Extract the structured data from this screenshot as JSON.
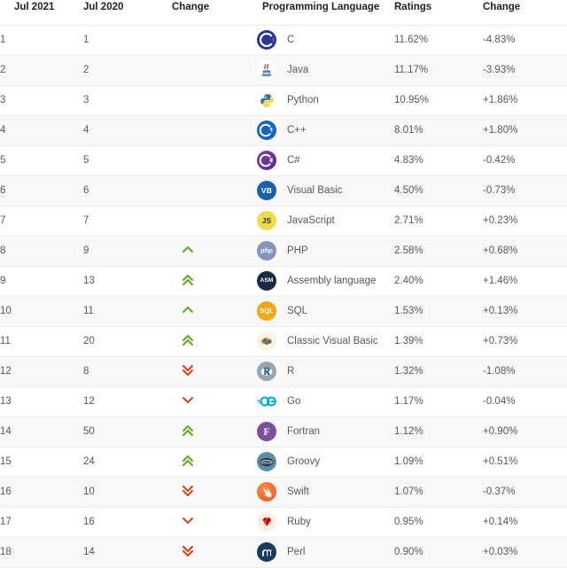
{
  "table": {
    "headers": {
      "rank_new": "Jul 2021",
      "rank_old": "Jul 2020",
      "change": "Change",
      "language": "Programming Language",
      "ratings": "Ratings",
      "delta": "Change"
    },
    "rows": [
      {
        "rank_new": "1",
        "rank_old": "1",
        "change": "",
        "icon": "c-logo-icon",
        "language": "C",
        "ratings": "11.62%",
        "delta": "-4.83%"
      },
      {
        "rank_new": "2",
        "rank_old": "2",
        "change": "",
        "icon": "java-logo-icon",
        "language": "Java",
        "ratings": "11.17%",
        "delta": "-3.93%"
      },
      {
        "rank_new": "3",
        "rank_old": "3",
        "change": "",
        "icon": "python-logo-icon",
        "language": "Python",
        "ratings": "10.95%",
        "delta": "+1.86%"
      },
      {
        "rank_new": "4",
        "rank_old": "4",
        "change": "",
        "icon": "cpp-logo-icon",
        "language": "C++",
        "ratings": "8.01%",
        "delta": "+1.80%"
      },
      {
        "rank_new": "5",
        "rank_old": "5",
        "change": "",
        "icon": "csharp-logo-icon",
        "language": "C#",
        "ratings": "4.83%",
        "delta": "-0.42%"
      },
      {
        "rank_new": "6",
        "rank_old": "6",
        "change": "",
        "icon": "visualbasic-logo-icon",
        "language": "Visual Basic",
        "ratings": "4.50%",
        "delta": "-0.73%"
      },
      {
        "rank_new": "7",
        "rank_old": "7",
        "change": "",
        "icon": "javascript-logo-icon",
        "language": "JavaScript",
        "ratings": "2.71%",
        "delta": "+0.23%"
      },
      {
        "rank_new": "8",
        "rank_old": "9",
        "change": "up",
        "icon": "php-logo-icon",
        "language": "PHP",
        "ratings": "2.58%",
        "delta": "+0.68%"
      },
      {
        "rank_new": "9",
        "rank_old": "13",
        "change": "double-up",
        "icon": "assembly-logo-icon",
        "language": "Assembly language",
        "ratings": "2.40%",
        "delta": "+1.46%"
      },
      {
        "rank_new": "10",
        "rank_old": "11",
        "change": "up",
        "icon": "sql-logo-icon",
        "language": "SQL",
        "ratings": "1.53%",
        "delta": "+0.13%"
      },
      {
        "rank_new": "11",
        "rank_old": "20",
        "change": "double-up",
        "icon": "classicvb-logo-icon",
        "language": "Classic Visual Basic",
        "ratings": "1.39%",
        "delta": "+0.73%"
      },
      {
        "rank_new": "12",
        "rank_old": "8",
        "change": "double-down",
        "icon": "r-logo-icon",
        "language": "R",
        "ratings": "1.32%",
        "delta": "-1.08%"
      },
      {
        "rank_new": "13",
        "rank_old": "12",
        "change": "down",
        "icon": "go-logo-icon",
        "language": "Go",
        "ratings": "1.17%",
        "delta": "-0.04%"
      },
      {
        "rank_new": "14",
        "rank_old": "50",
        "change": "double-up",
        "icon": "fortran-logo-icon",
        "language": "Fortran",
        "ratings": "1.12%",
        "delta": "+0.90%"
      },
      {
        "rank_new": "15",
        "rank_old": "24",
        "change": "double-up",
        "icon": "groovy-logo-icon",
        "language": "Groovy",
        "ratings": "1.09%",
        "delta": "+0.51%"
      },
      {
        "rank_new": "16",
        "rank_old": "10",
        "change": "double-down",
        "icon": "swift-logo-icon",
        "language": "Swift",
        "ratings": "1.07%",
        "delta": "-0.37%"
      },
      {
        "rank_new": "17",
        "rank_old": "16",
        "change": "down",
        "icon": "ruby-logo-icon",
        "language": "Ruby",
        "ratings": "0.95%",
        "delta": "+0.14%"
      },
      {
        "rank_new": "18",
        "rank_old": "14",
        "change": "double-down",
        "icon": "perl-logo-icon",
        "language": "Perl",
        "ratings": "0.90%",
        "delta": "+0.03%"
      }
    ]
  },
  "colors": {
    "up_arrow": "#63a91f",
    "down_arrow": "#d9441a",
    "header_text": "#222222",
    "body_text": "#58585a",
    "row_alt_bg": "#f8f8f8",
    "row_border": "#ececec"
  }
}
